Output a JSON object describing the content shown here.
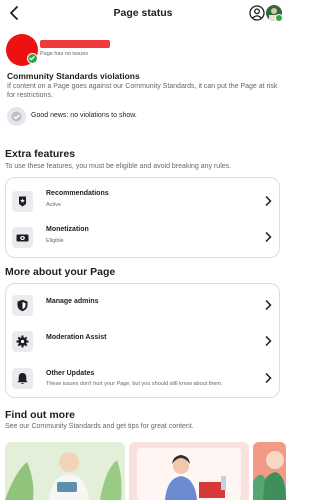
{
  "header": {
    "title": "Page status"
  },
  "page": {
    "status_text": "Page has no issues"
  },
  "community_standards": {
    "title": "Community Standards violations",
    "description": "If content on a Page goes against our Community Standards, it can put the Page at risk for restrictions.",
    "good_news": "Good news: no violations to show."
  },
  "extra_features": {
    "title": "Extra features",
    "description": "To use these features, you must be eligible and avoid breaking any rules.",
    "items": [
      {
        "label": "Recommendations",
        "status": "Active",
        "icon": "star-badge-icon"
      },
      {
        "label": "Monetization",
        "status": "Eligible",
        "icon": "money-icon"
      }
    ]
  },
  "more_about": {
    "title": "More about your Page",
    "items": [
      {
        "label": "Manage admins",
        "icon": "shield-icon"
      },
      {
        "label": "Moderation Assist",
        "icon": "gear-icon"
      },
      {
        "label": "Other Updates",
        "description": "These issues don't hurt your Page, but you should still know about them.",
        "icon": "bell-icon"
      }
    ]
  },
  "find_out_more": {
    "title": "Find out more",
    "description": "See our Community Standards and get tips for great content."
  },
  "colors": {
    "accent_red": "#ee1111",
    "check_green": "#31a24c",
    "card_border": "#dadde1"
  }
}
